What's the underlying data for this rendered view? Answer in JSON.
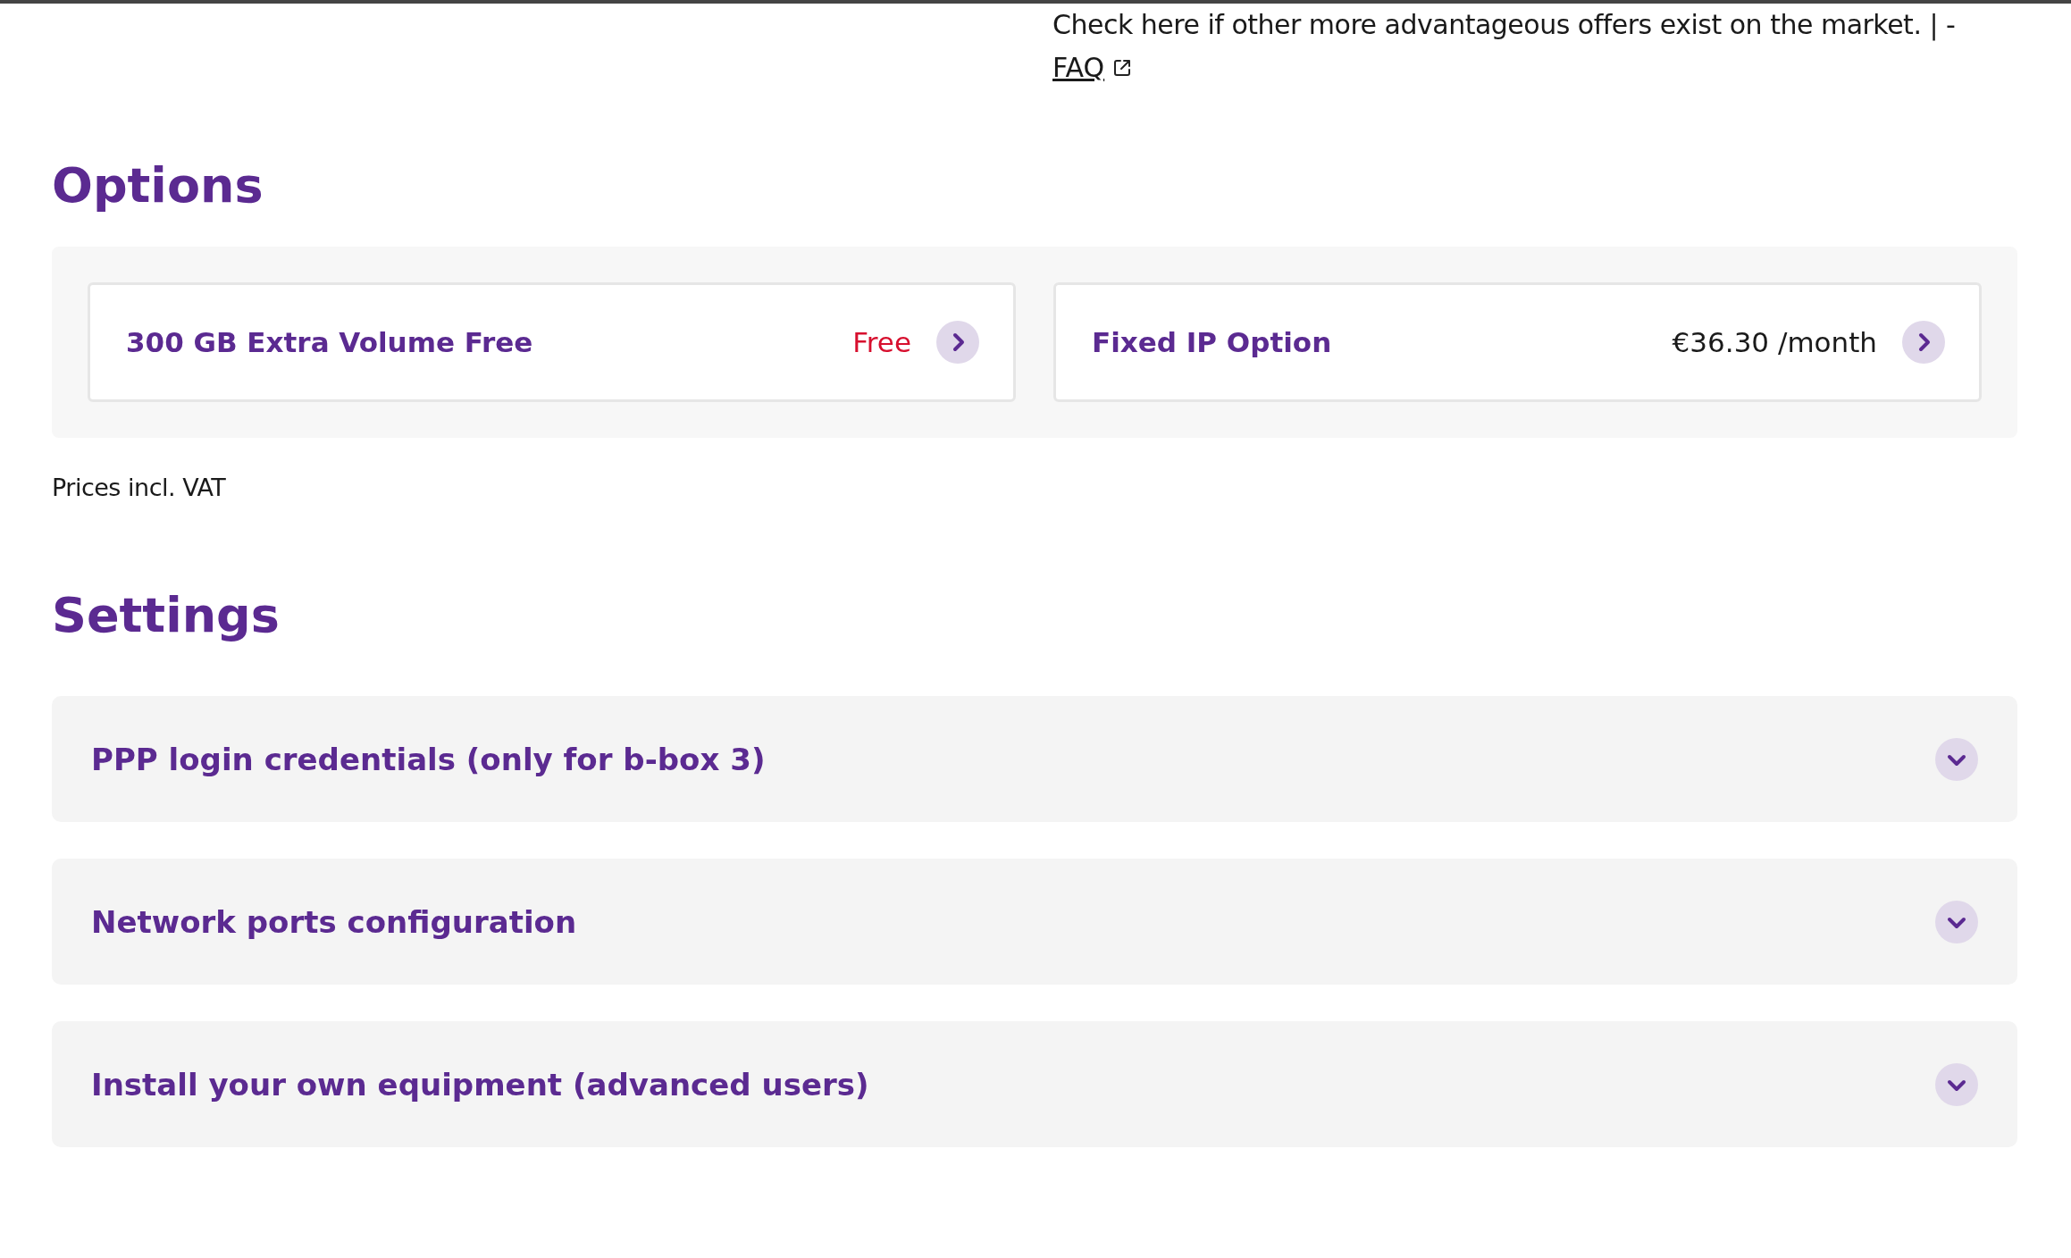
{
  "note": {
    "text": "Check here if other more advantageous offers exist on the market. | -",
    "link": "FAQ"
  },
  "options": {
    "title": "Options",
    "cards": [
      {
        "label": "300 GB Extra Volume Free",
        "price": "Free",
        "kind": "free"
      },
      {
        "label": "Fixed IP Option",
        "price": "€36.30 /month",
        "kind": "regular"
      }
    ],
    "footnote": "Prices incl. VAT"
  },
  "settings": {
    "title": "Settings",
    "sections": [
      {
        "label": "PPP login credentials (only for b-box 3)",
        "expanded": false
      },
      {
        "label": "Network ports configuration",
        "expanded": false
      },
      {
        "label": "Install your own equipment (advanced users)",
        "expanded": false
      }
    ]
  }
}
